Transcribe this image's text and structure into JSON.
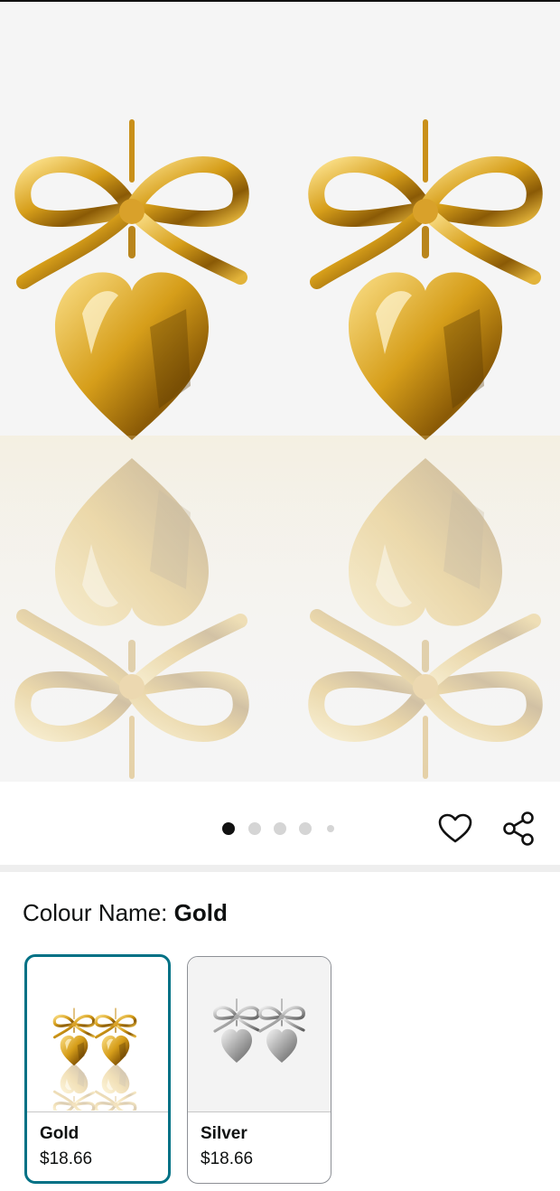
{
  "product": {
    "image_alt": "Gold bow heart drop earrings",
    "image_count": 5,
    "active_image_index": 0
  },
  "colour": {
    "label": "Colour Name:",
    "selected": "Gold"
  },
  "variants": [
    {
      "name": "Gold",
      "price": "$18.66",
      "selected": true
    },
    {
      "name": "Silver",
      "price": "$18.66",
      "selected": false
    }
  ],
  "icons": {
    "wishlist": "heart-outline-icon",
    "share": "share-icon"
  },
  "colors": {
    "accent": "#007185",
    "gold": "#d4a017",
    "silver": "#a9a9a9"
  }
}
